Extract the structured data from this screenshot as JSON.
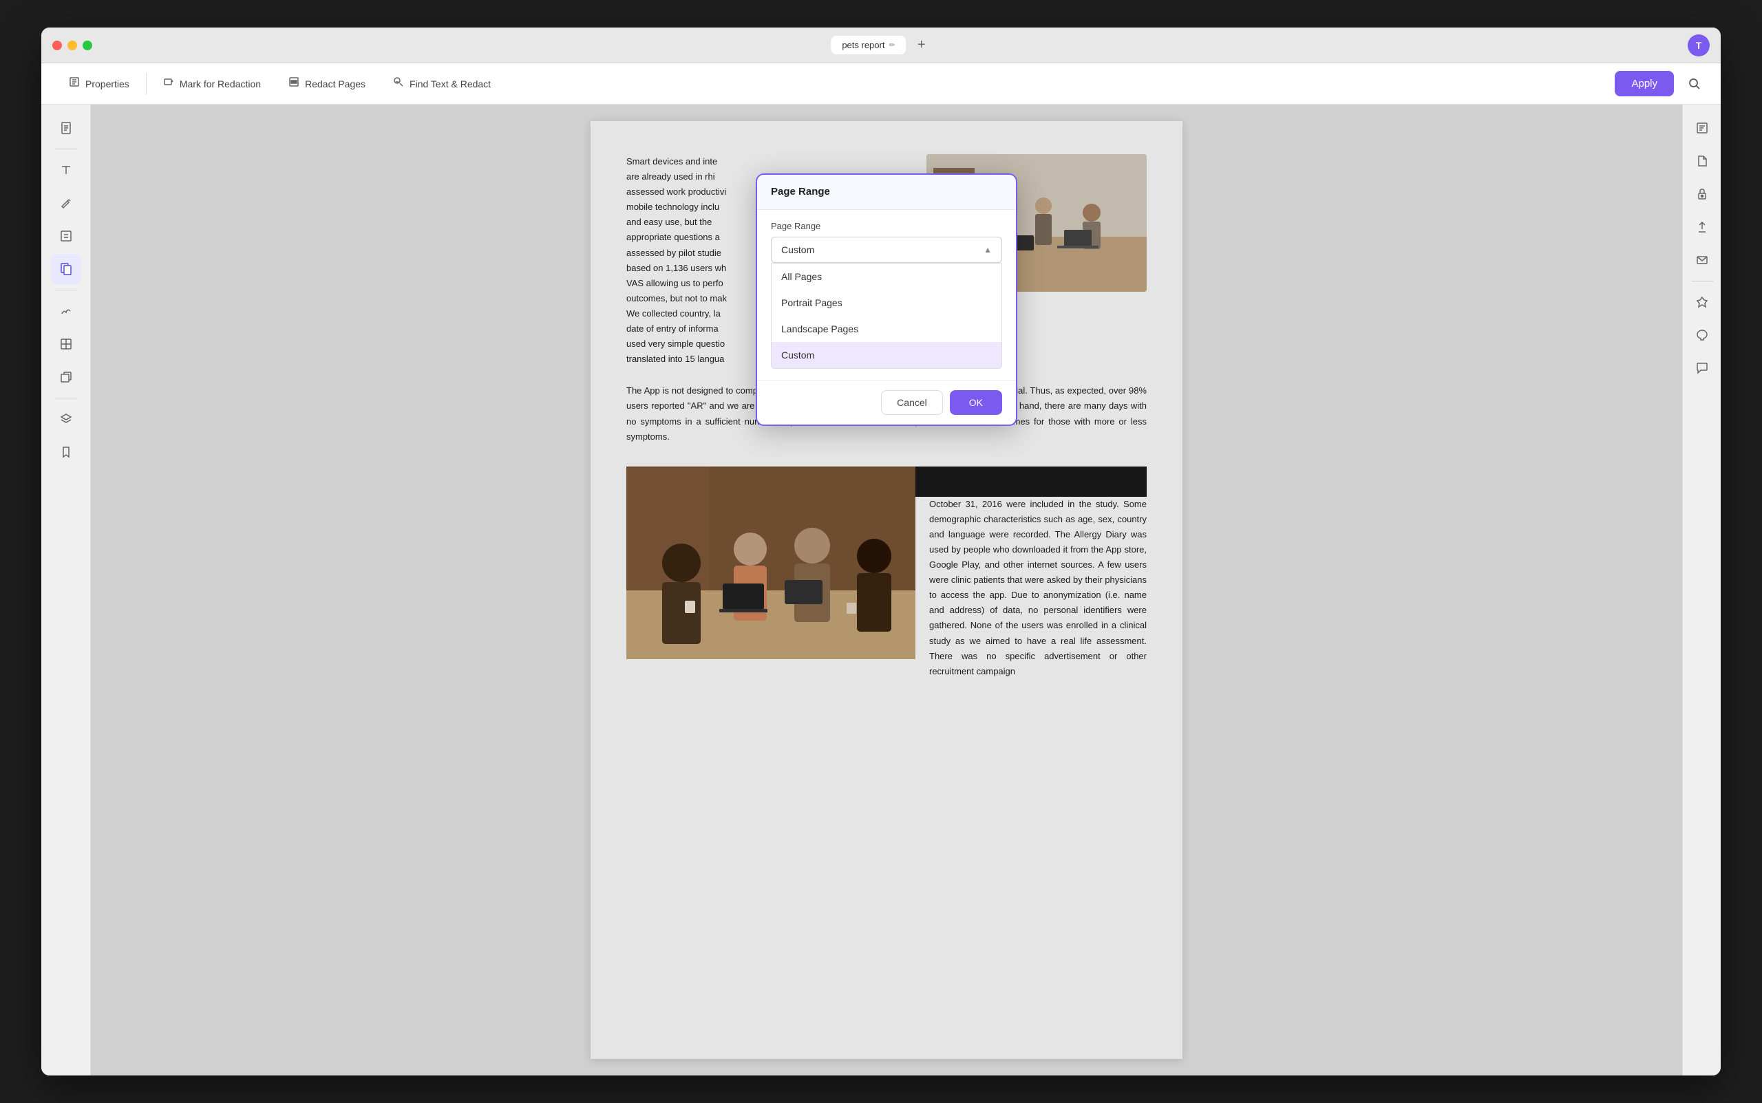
{
  "window": {
    "title": "pets report",
    "tab_label": "pets report"
  },
  "toolbar": {
    "properties_label": "Properties",
    "mark_redaction_label": "Mark for Redaction",
    "redact_pages_label": "Redact Pages",
    "find_redact_label": "Find Text & Redact",
    "apply_label": "Apply"
  },
  "modal": {
    "title": "Page Range",
    "page_range_label": "Page Range",
    "selected_value": "Custom",
    "options": [
      {
        "label": "All Pages",
        "selected": false
      },
      {
        "label": "Portrait Pages",
        "selected": false
      },
      {
        "label": "Landscape Pages",
        "selected": false
      },
      {
        "label": "Custom",
        "selected": true
      }
    ],
    "cancel_label": "Cancel",
    "ok_label": "OK"
  },
  "document": {
    "paragraph1": "Smart devices and inte are already used in rhi assessed work productivi mobile technology inclu and easy use, but the appropriate questions a assessed by pilot studie based on 1,136 users wh VAS allowing us to perfo outcomes, but not to mak We collected country, la date of entry of informa used very simple questio translated into 15 langua",
    "paragraph2": "The App is not designed to compare AR patients with control subjects and this was not a clinical trial. Thus, as expected, over 98% users reported \"AR\" and we are unable to assess the responses of \"non AR\" users. On the other hand, there are many days with no symptoms in a sufficient number of persons with AR to allow comparisons between outcomes for those with more or less symptoms.",
    "paragraph3": "October 31, 2016 were included in the study. Some demographic characteristics such as age, sex, country and language were recorded. The Allergy Diary was used by people who downloaded it from the App store, Google Play, and other internet sources. A few users were clinic patients that were asked by their physicians to access the app. Due to anonymization (i.e. name and address) of data, no personal identifiers were gathered. None of the users was enrolled in a clinical study as we aimed to have a real life assessment. There was no specific advertisement or other recruitment campaign"
  },
  "sidebar": {
    "icons": [
      {
        "name": "document-icon",
        "symbol": "📄",
        "active": false
      },
      {
        "name": "text-icon",
        "symbol": "A",
        "active": false
      },
      {
        "name": "edit-icon",
        "symbol": "✏️",
        "active": false
      },
      {
        "name": "list-icon",
        "symbol": "☰",
        "active": false
      },
      {
        "name": "page-icon",
        "symbol": "📋",
        "active": true
      },
      {
        "name": "signature-icon",
        "symbol": "✍️",
        "active": false
      },
      {
        "name": "table-icon",
        "symbol": "⊞",
        "active": false
      },
      {
        "name": "copy-icon",
        "symbol": "⧉",
        "active": false
      },
      {
        "name": "layers-icon",
        "symbol": "◫",
        "active": false
      },
      {
        "name": "bookmark-icon",
        "symbol": "🔖",
        "active": false
      }
    ]
  },
  "right_sidebar": {
    "icons": [
      {
        "name": "ocr-icon",
        "symbol": "OCR"
      },
      {
        "name": "file-icon",
        "symbol": "📁"
      },
      {
        "name": "lock-icon",
        "symbol": "🔒"
      },
      {
        "name": "export-icon",
        "symbol": "↑"
      },
      {
        "name": "mail-icon",
        "symbol": "✉"
      },
      {
        "name": "stamp-icon",
        "symbol": "⬡"
      },
      {
        "name": "color-icon",
        "symbol": "✦"
      },
      {
        "name": "comment-icon",
        "symbol": "💬"
      }
    ]
  },
  "user": {
    "initial": "T"
  }
}
